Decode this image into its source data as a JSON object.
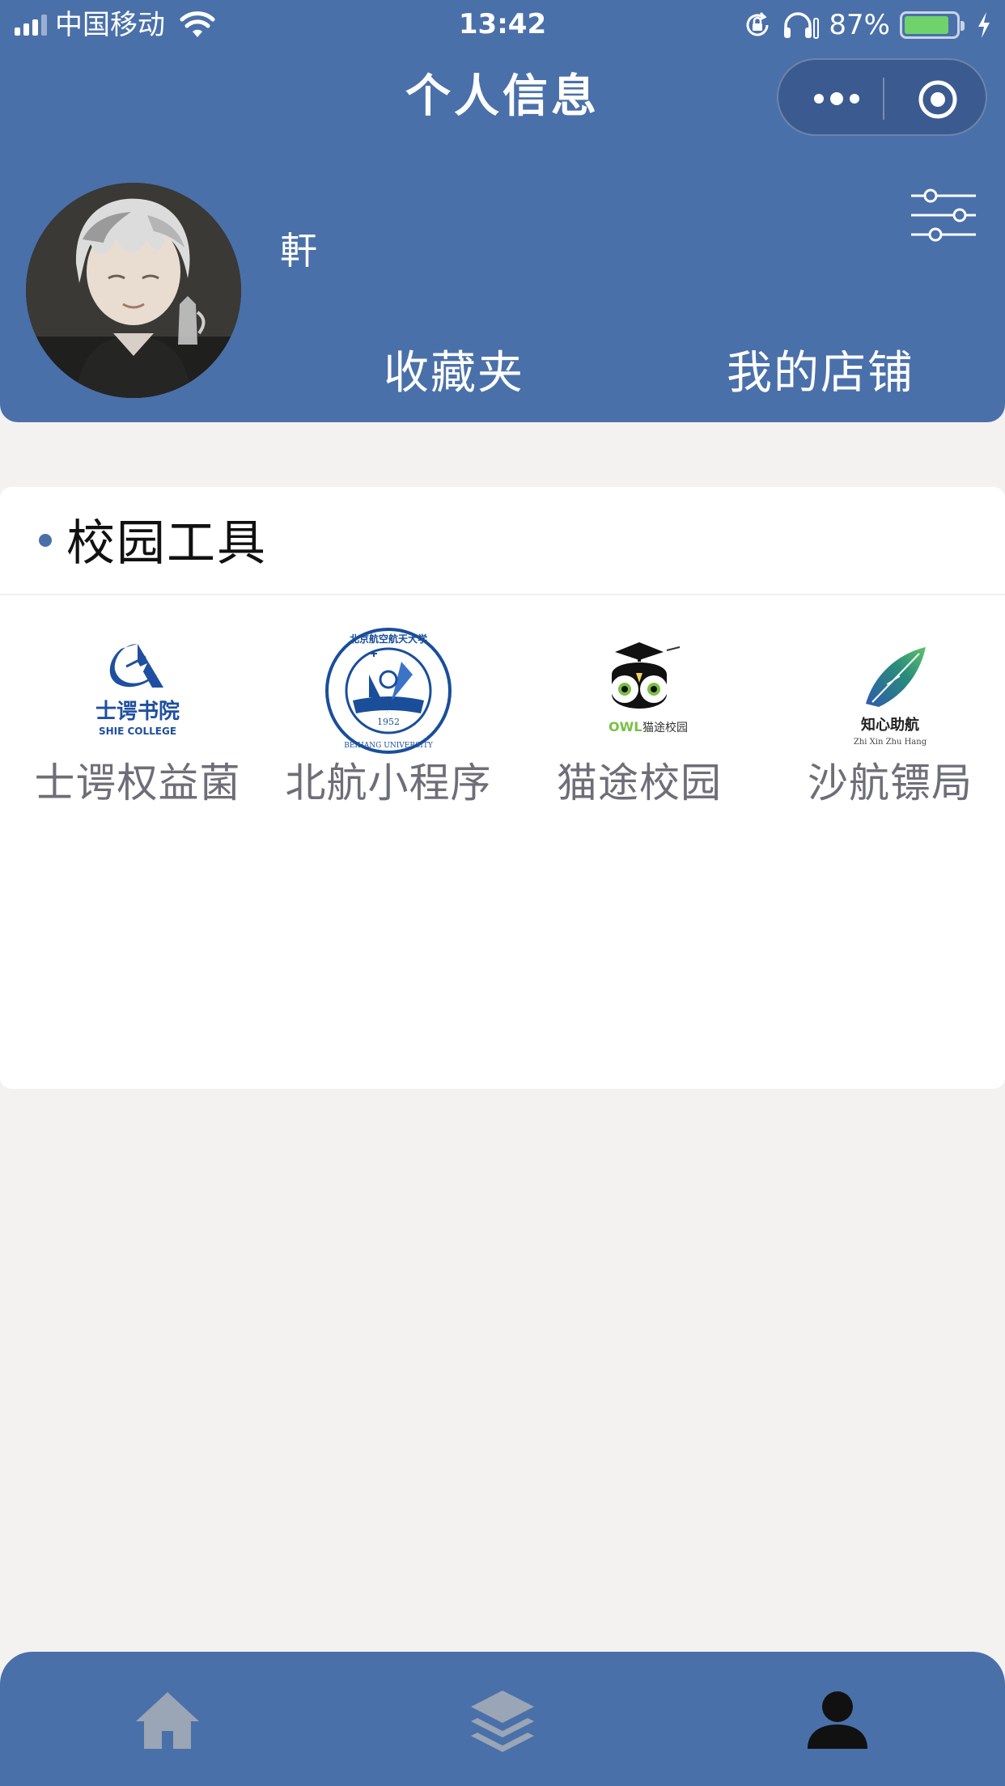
{
  "status_bar": {
    "carrier": "中国移动",
    "time": "13:42",
    "battery_percent": "87%",
    "battery_level": 0.87,
    "icons": [
      "signal-icon",
      "wifi-icon",
      "rotation-lock-icon",
      "headphones-icon",
      "battery-icon",
      "charging-icon"
    ]
  },
  "nav": {
    "title": "个人信息",
    "capsule_icons": [
      "more-dots-icon",
      "close-target-icon"
    ]
  },
  "profile": {
    "username": "軒",
    "links": {
      "favorites": "收藏夹",
      "my_shop": "我的店铺"
    },
    "settings_icon": "filter-sliders-icon"
  },
  "campus_tools": {
    "title": "校园工具",
    "items": [
      {
        "label": "士谔权益菌",
        "logo_text": "士谔书院",
        "logo_subtext": "SHIE COLLEGE",
        "accent": "#1f4fa0"
      },
      {
        "label": "北航小程序",
        "logo_text": "北京航空航天大学",
        "logo_subtext": "BEIHANG UNIVERSITY",
        "logo_year": "1952",
        "accent": "#1a4e9a"
      },
      {
        "label": "猫途校园",
        "logo_text": "猫途校园",
        "logo_subtext": "OWL",
        "accent": "#79c043"
      },
      {
        "label": "沙航镖局",
        "logo_text": "知心助航",
        "logo_subtext": "Zhi Xin Zhu Hang",
        "accent": "#2a8c7a"
      }
    ]
  },
  "tabbar": {
    "tabs": [
      {
        "icon": "home-icon",
        "active": false
      },
      {
        "icon": "layers-icon",
        "active": false
      },
      {
        "icon": "user-icon",
        "active": true
      }
    ],
    "active_color": "#111111",
    "inactive_color": "#9aa5b5"
  },
  "colors": {
    "primary": "#4a70aa",
    "background": "#f4f1f1",
    "label_gray": "#6d6e78"
  }
}
